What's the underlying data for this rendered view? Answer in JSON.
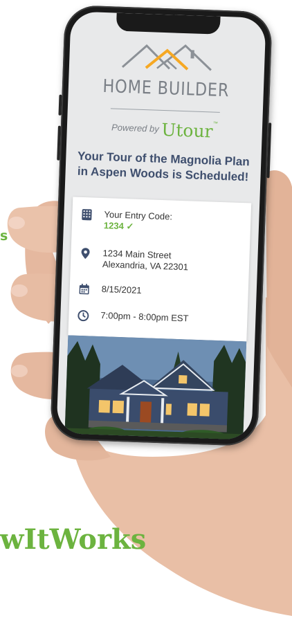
{
  "side_text": {
    "left_green_fragment": "s"
  },
  "footer": {
    "tagline": "wItWorks"
  },
  "app": {
    "brand": "HOME BUILDER",
    "powered_by": "Powered by",
    "powered_brand": "Utour",
    "headline_line1": "Your Tour of the Magnolia Plan",
    "headline_line2": "in Aspen Woods is Scheduled!"
  },
  "details": {
    "entry_code_label": "Your Entry Code:",
    "entry_code": "1234",
    "entry_code_check": "✓",
    "address_line1": "1234 Main Street",
    "address_line2": "Alexandria, VA 22301",
    "date": "8/15/2021",
    "time": "7:00pm - 8:00pm EST"
  },
  "icons": [
    "keypad-icon",
    "location-pin-icon",
    "calendar-icon",
    "clock-icon"
  ],
  "colors": {
    "green": "#6cb33f",
    "navy": "#3f4f6e",
    "gray": "#7a7f86",
    "orange": "#f6a823"
  }
}
